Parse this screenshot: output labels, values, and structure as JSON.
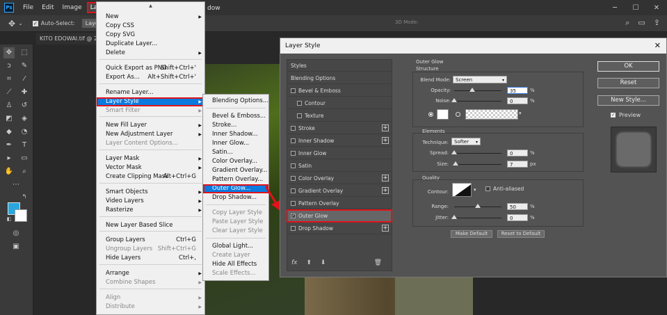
{
  "app": {
    "logo": "Ps"
  },
  "menubar": {
    "items": [
      "File",
      "Edit",
      "Image",
      "Layer"
    ],
    "window_partial": "dow"
  },
  "optionsbar": {
    "auto_select": "Auto-Select:",
    "target": "Layer",
    "mode_3d": "3D Mode:"
  },
  "document": {
    "tab": "KITO EDOWAI.tif @ 25"
  },
  "layer_menu": {
    "items": [
      {
        "label": "New",
        "shortcut": "",
        "arrow": true,
        "disabled": false
      },
      {
        "label": "Copy CSS",
        "shortcut": "",
        "arrow": false,
        "disabled": false
      },
      {
        "label": "Copy SVG",
        "shortcut": "",
        "arrow": false,
        "disabled": false
      },
      {
        "label": "Duplicate Layer...",
        "shortcut": "",
        "arrow": false,
        "disabled": false
      },
      {
        "label": "Delete",
        "shortcut": "",
        "arrow": true,
        "disabled": false
      },
      {
        "label": "Quick Export as PNG",
        "shortcut": "Shift+Ctrl+'",
        "arrow": false,
        "disabled": false
      },
      {
        "label": "Export As...",
        "shortcut": "Alt+Shift+Ctrl+'",
        "arrow": false,
        "disabled": false
      },
      {
        "label": "Rename Layer...",
        "shortcut": "",
        "arrow": false,
        "disabled": false
      },
      {
        "label": "Layer Style",
        "shortcut": "",
        "arrow": true,
        "disabled": false
      },
      {
        "label": "Smart Filter",
        "shortcut": "",
        "arrow": true,
        "disabled": true
      },
      {
        "label": "New Fill Layer",
        "shortcut": "",
        "arrow": true,
        "disabled": false
      },
      {
        "label": "New Adjustment Layer",
        "shortcut": "",
        "arrow": true,
        "disabled": false
      },
      {
        "label": "Layer Content Options...",
        "shortcut": "",
        "arrow": false,
        "disabled": true
      },
      {
        "label": "Layer Mask",
        "shortcut": "",
        "arrow": true,
        "disabled": false
      },
      {
        "label": "Vector Mask",
        "shortcut": "",
        "arrow": true,
        "disabled": false
      },
      {
        "label": "Create Clipping Mask",
        "shortcut": "Alt+Ctrl+G",
        "arrow": false,
        "disabled": false
      },
      {
        "label": "Smart Objects",
        "shortcut": "",
        "arrow": true,
        "disabled": false
      },
      {
        "label": "Video Layers",
        "shortcut": "",
        "arrow": true,
        "disabled": false
      },
      {
        "label": "Rasterize",
        "shortcut": "",
        "arrow": true,
        "disabled": false
      },
      {
        "label": "New Layer Based Slice",
        "shortcut": "",
        "arrow": false,
        "disabled": false
      },
      {
        "label": "Group Layers",
        "shortcut": "Ctrl+G",
        "arrow": false,
        "disabled": false
      },
      {
        "label": "Ungroup Layers",
        "shortcut": "Shift+Ctrl+G",
        "arrow": false,
        "disabled": true
      },
      {
        "label": "Hide Layers",
        "shortcut": "Ctrl+,",
        "arrow": false,
        "disabled": false
      },
      {
        "label": "Arrange",
        "shortcut": "",
        "arrow": true,
        "disabled": false
      },
      {
        "label": "Combine Shapes",
        "shortcut": "",
        "arrow": true,
        "disabled": true
      },
      {
        "label": "Align",
        "shortcut": "",
        "arrow": true,
        "disabled": true
      },
      {
        "label": "Distribute",
        "shortcut": "",
        "arrow": true,
        "disabled": true
      }
    ]
  },
  "layer_style_submenu": {
    "items": [
      {
        "label": "Blending Options...",
        "disabled": false
      },
      {
        "label": "Bevel & Emboss...",
        "disabled": false
      },
      {
        "label": "Stroke...",
        "disabled": false
      },
      {
        "label": "Inner Shadow...",
        "disabled": false
      },
      {
        "label": "Inner Glow...",
        "disabled": false
      },
      {
        "label": "Satin...",
        "disabled": false
      },
      {
        "label": "Color Overlay...",
        "disabled": false
      },
      {
        "label": "Gradient Overlay...",
        "disabled": false
      },
      {
        "label": "Pattern Overlay...",
        "disabled": false
      },
      {
        "label": "Outer Glow...",
        "disabled": false
      },
      {
        "label": "Drop Shadow...",
        "disabled": false
      },
      {
        "label": "Copy Layer Style",
        "disabled": true
      },
      {
        "label": "Paste Layer Style",
        "disabled": true
      },
      {
        "label": "Clear Layer Style",
        "disabled": true
      },
      {
        "label": "Global Light...",
        "disabled": false
      },
      {
        "label": "Create Layer",
        "disabled": true
      },
      {
        "label": "Hide All Effects",
        "disabled": false
      },
      {
        "label": "Scale Effects...",
        "disabled": true
      }
    ]
  },
  "dialog": {
    "title": "Layer Style",
    "close": "✕",
    "styles_header": "Styles",
    "style_items": [
      {
        "label": "Blending Options",
        "checkbox": false,
        "checked": false,
        "plus": false,
        "indent": false
      },
      {
        "label": "Bevel & Emboss",
        "checkbox": true,
        "checked": false,
        "plus": false,
        "indent": false
      },
      {
        "label": "Contour",
        "checkbox": true,
        "checked": false,
        "plus": false,
        "indent": true
      },
      {
        "label": "Texture",
        "checkbox": true,
        "checked": false,
        "plus": false,
        "indent": true
      },
      {
        "label": "Stroke",
        "checkbox": true,
        "checked": false,
        "plus": true,
        "indent": false
      },
      {
        "label": "Inner Shadow",
        "checkbox": true,
        "checked": false,
        "plus": true,
        "indent": false
      },
      {
        "label": "Inner Glow",
        "checkbox": true,
        "checked": false,
        "plus": false,
        "indent": false
      },
      {
        "label": "Satin",
        "checkbox": true,
        "checked": false,
        "plus": false,
        "indent": false
      },
      {
        "label": "Color Overlay",
        "checkbox": true,
        "checked": false,
        "plus": true,
        "indent": false
      },
      {
        "label": "Gradient Overlay",
        "checkbox": true,
        "checked": false,
        "plus": true,
        "indent": false
      },
      {
        "label": "Pattern Overlay",
        "checkbox": true,
        "checked": false,
        "plus": false,
        "indent": false
      },
      {
        "label": "Outer Glow",
        "checkbox": true,
        "checked": true,
        "plus": false,
        "indent": false
      },
      {
        "label": "Drop Shadow",
        "checkbox": true,
        "checked": false,
        "plus": true,
        "indent": false
      }
    ],
    "fx": "fx",
    "outer_glow": {
      "title": "Outer Glow",
      "structure": "Structure",
      "blend_mode_label": "Blend Mode:",
      "blend_mode": "Screen",
      "opacity_label": "Opacity:",
      "opacity": "35",
      "noise_label": "Noise:",
      "noise": "0",
      "percent": "%",
      "elements": "Elements",
      "technique_label": "Technique:",
      "technique": "Softer",
      "spread_label": "Spread:",
      "spread": "0",
      "size_label": "Size:",
      "size": "7",
      "px": "px",
      "quality": "Quality",
      "contour_label": "Contour:",
      "anti_aliased": "Anti-aliased",
      "range_label": "Range:",
      "range": "50",
      "jitter_label": "Jitter:",
      "jitter": "0",
      "make_default": "Make Default",
      "reset_default": "Reset to Default"
    },
    "ok": "OK",
    "reset": "Reset",
    "new_style": "New Style...",
    "preview": "Preview"
  }
}
